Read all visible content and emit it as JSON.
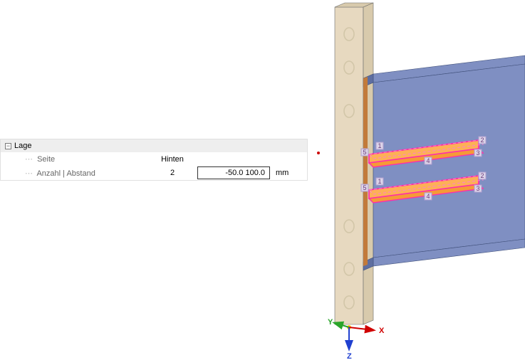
{
  "panel": {
    "group_label": "Lage",
    "toggle_glyph": "−",
    "rows": [
      {
        "label": "Seite",
        "val1": "Hinten",
        "val2": "",
        "unit": ""
      },
      {
        "label": "Anzahl | Abstand",
        "val1": "2",
        "val2": "-50.0 100.0",
        "unit": "mm"
      }
    ]
  },
  "viewport": {
    "axes": {
      "x": "X",
      "y": "Y",
      "z": "Z"
    },
    "colors": {
      "plate": "#e7d9c0",
      "plate_shade": "#d8caac",
      "beam": "#7f8fc2",
      "beam_dark": "#5e6ea0",
      "stiffener_fill": "#fdb057",
      "stiffener_edge": "#ff2fa8",
      "stiffener_dash": "#ff7ed0",
      "bolt_hole": "#d2c6a8",
      "node_box_bg": "#dcd3e8",
      "node_box_border": "#b09fd0",
      "axis_x": "#d00000",
      "axis_y": "#2aa52a",
      "axis_z": "#2040d0"
    },
    "stiffener_nodes": {
      "top": [
        "5",
        "1",
        "2",
        "4",
        "3"
      ],
      "bottom": [
        "5",
        "1",
        "2",
        "4",
        "3"
      ]
    }
  }
}
